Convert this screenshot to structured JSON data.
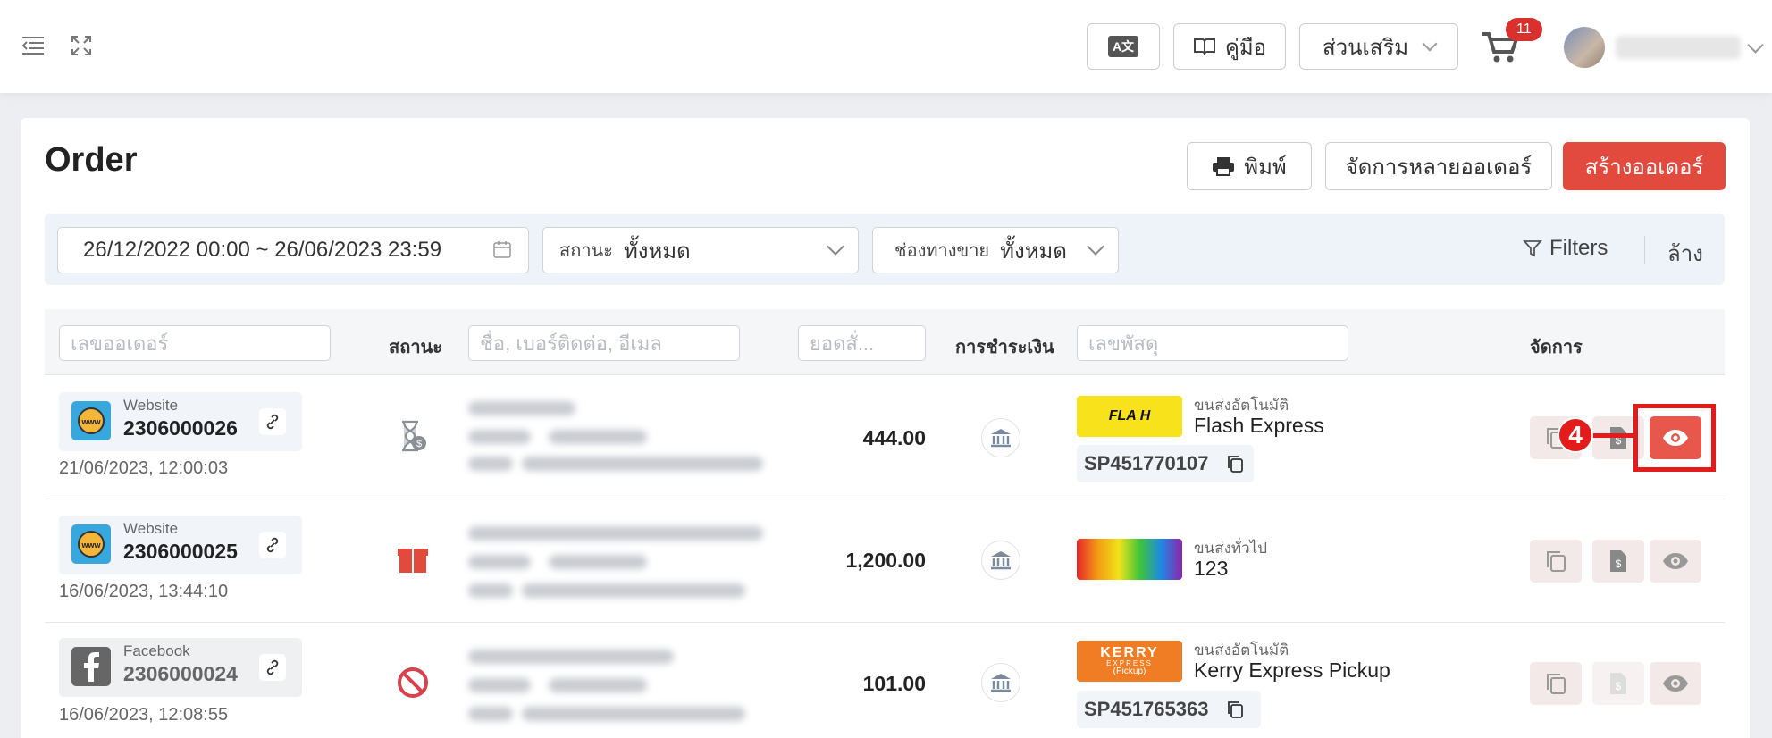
{
  "topbar": {
    "translate_label": "A文",
    "manual_label": "คู่มือ",
    "extras_label": "ส่วนเสริม",
    "cart_count": "11"
  },
  "page": {
    "title": "Order",
    "print_label": "พิมพ์",
    "bulk_label": "จัดการหลายออเดอร์",
    "create_label": "สร้างออเดอร์"
  },
  "filters": {
    "date_range": "26/12/2022 00:00  ~ 26/06/2023 23:59",
    "status_label": "สถานะ",
    "status_value": "ทั้งหมด",
    "channel_label": "ช่องทางขาย",
    "channel_value": "ทั้งหมด",
    "filters_label": "Filters",
    "clear_label": "ล้าง"
  },
  "table": {
    "order_placeholder": "เลขออเดอร์",
    "status_header": "สถานะ",
    "customer_placeholder": "ชื่อ, เบอร์ติดต่อ, อีเมล",
    "amount_placeholder": "ยอดสั่...",
    "payment_header": "การชำระเงิน",
    "tracking_placeholder": "เลขพัสดุ",
    "manage_header": "จัดการ"
  },
  "rows": [
    {
      "channel": "Website",
      "order_no": "2306000026",
      "date": "21/06/2023, 12:00:03",
      "status_icon": "hourglass-payment-icon",
      "amount": "444.00",
      "ship_type": "ขนส่งอัตโนมัติ",
      "ship_name": "Flash Express",
      "tracking": "SP451770107"
    },
    {
      "channel": "Website",
      "order_no": "2306000025",
      "date": "16/06/2023, 13:44:10",
      "status_icon": "package-icon",
      "amount": "1,200.00",
      "ship_type": "ขนส่งทั่วไป",
      "ship_name": "123",
      "tracking": ""
    },
    {
      "channel": "Facebook",
      "order_no": "2306000024",
      "date": "16/06/2023, 12:08:55",
      "status_icon": "cancelled-icon",
      "amount": "101.00",
      "ship_type": "ขนส่งอัตโนมัติ",
      "ship_name": "Kerry Express Pickup",
      "tracking": "SP451765363"
    }
  ],
  "logos": {
    "flash": "FLA H",
    "kerry_main": "KERRY",
    "kerry_sub": "EXPRESS",
    "kerry_pickup": "(Pickup)"
  },
  "annotation": {
    "step": "4"
  },
  "colors": {
    "accent": "#e34a3e",
    "annotation": "#e31b1b",
    "panel": "#eef3f9"
  }
}
